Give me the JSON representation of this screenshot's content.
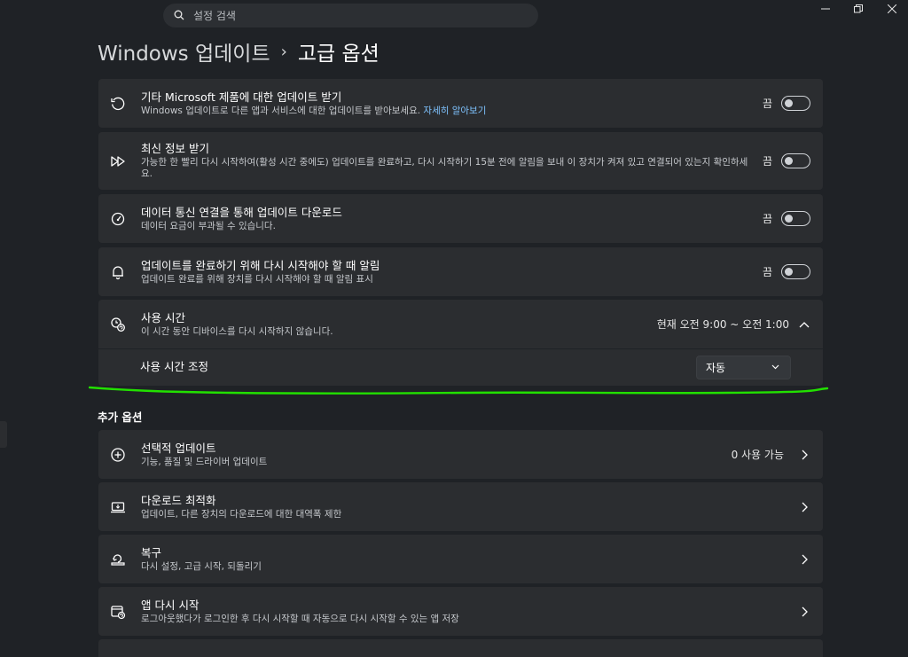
{
  "search": {
    "placeholder": "설정 검색"
  },
  "breadcrumb": {
    "parent": "Windows 업데이트",
    "separator": "›",
    "current": "고급 옵션"
  },
  "settings": [
    {
      "title": "기타 Microsoft 제품에 대한 업데이트 받기",
      "subtitle": "Windows 업데이트로 다른 앱과 서비스에 대한 업데이트를 받아보세요.",
      "link": "자세히 알아보기",
      "state": "끔",
      "icon": "refresh-icon"
    },
    {
      "title": "최신 정보 받기",
      "subtitle": "가능한 한 빨리 다시 시작하여(활성 시간 중에도) 업데이트를 완료하고, 다시 시작하기 15분 전에 알림을 보내 이 장치가 켜져 있고 연결되어 있는지 확인하세요.",
      "state": "끔",
      "icon": "fast-forward-icon"
    },
    {
      "title": "데이터 통신 연결을 통해 업데이트 다운로드",
      "subtitle": "데이터 요금이 부과될 수 있습니다.",
      "state": "끔",
      "icon": "gauge-icon"
    },
    {
      "title": "업데이트를 완료하기 위해 다시 시작해야 할 때 알림",
      "subtitle": "업데이트 완료를 위해 장치를 다시 시작해야 할 때 알림 표시",
      "state": "끔",
      "icon": "bell-icon"
    }
  ],
  "active_hours": {
    "title": "사용 시간",
    "subtitle": "이 시간 동안 디바이스를 다시 시작하지 않습니다.",
    "value": "현재 오전 9:00 ~ 오전 1:00",
    "adjust_label": "사용 시간 조정",
    "adjust_value": "자동"
  },
  "additional": {
    "heading": "추가 옵션",
    "items": [
      {
        "title": "선택적 업데이트",
        "subtitle": "기능, 품질 및 드라이버 업데이트",
        "right": "0 사용 가능",
        "icon": "plus-circle-icon"
      },
      {
        "title": "다운로드 최적화",
        "subtitle": "업데이트, 다른 장치의 다운로드에 대한 대역폭 제한",
        "right": "",
        "icon": "laptop-download-icon"
      },
      {
        "title": "복구",
        "subtitle": "다시 설정, 고급 시작, 되돌리기",
        "right": "",
        "icon": "recovery-icon"
      },
      {
        "title": "앱 다시 시작",
        "subtitle": "로그아웃했다가 로그인한 후 다시 시작할 때 자동으로 다시 시작할 수 있는 앱 저장",
        "right": "",
        "icon": "app-restart-icon"
      }
    ]
  },
  "colors": {
    "background": "#1f2226",
    "card": "#2b2d30",
    "link": "#7fc3ff",
    "annotation": "#22e000"
  }
}
